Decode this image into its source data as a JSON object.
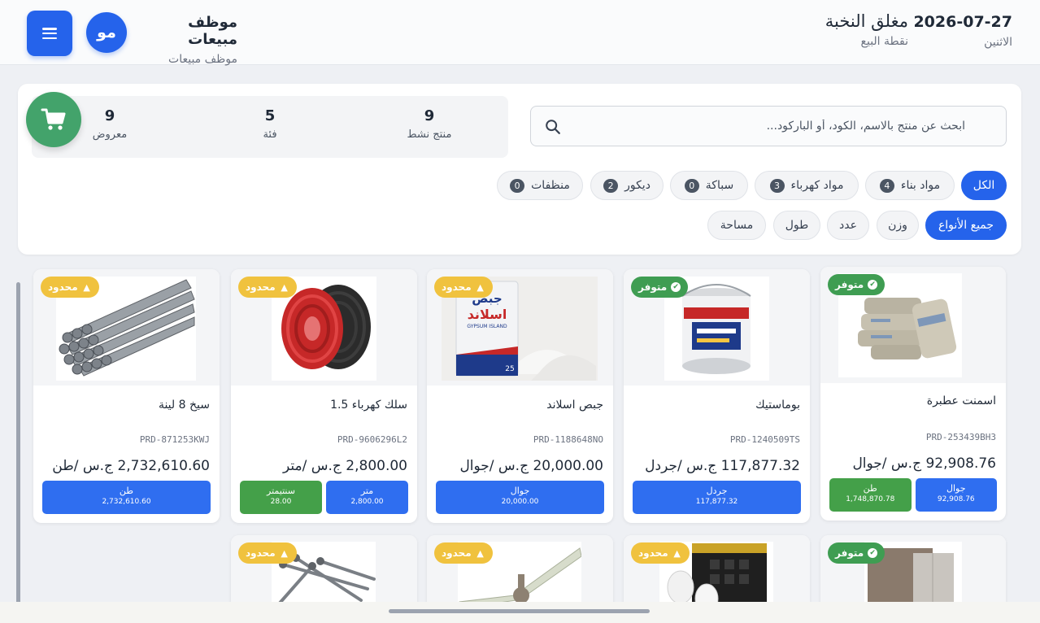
{
  "header": {
    "date": "2026-07-27",
    "weekday": "الاثنين",
    "store_name": "مغلق النخبة",
    "store_sub": "نقطة البيع",
    "user_name": "موظف مبيعات",
    "user_role": "موظف مبيعات",
    "avatar_initials": "مو",
    "menu_icon": "hamburger-icon"
  },
  "search": {
    "placeholder": "ابحث عن منتج بالاسم، الكود، أو الباركود...",
    "value": "",
    "icon": "search-icon"
  },
  "stats": [
    {
      "value": "9",
      "label": "منتج نشط"
    },
    {
      "value": "5",
      "label": "فئة"
    },
    {
      "value": "9",
      "label": "معروض"
    }
  ],
  "cart_icon": "cart-icon",
  "categories": [
    {
      "label": "الكل",
      "count": "",
      "active": true
    },
    {
      "label": "مواد بناء",
      "count": "4",
      "active": false
    },
    {
      "label": "مواد كهرباء",
      "count": "3",
      "active": false
    },
    {
      "label": "سباكة",
      "count": "0",
      "active": false
    },
    {
      "label": "ديكور",
      "count": "2",
      "active": false
    },
    {
      "label": "منظفات",
      "count": "0",
      "active": false
    }
  ],
  "unit_types": [
    {
      "label": "جميع الأنواع",
      "active": true
    },
    {
      "label": "وزن",
      "active": false
    },
    {
      "label": "عدد",
      "active": false
    },
    {
      "label": "طول",
      "active": false
    },
    {
      "label": "مساحة",
      "active": false
    }
  ],
  "colors": {
    "primary": "#2563eb",
    "success": "#3f9d52",
    "warning": "#f0c23e",
    "cart": "#43a36b"
  },
  "products": [
    {
      "name": "اسمنت عطبرة",
      "sku": "PRD-253439BH3",
      "price": "92,908.76 ج.س /جوال",
      "badge": "متوفر",
      "badge_type": "avail",
      "units": [
        {
          "name": "جوال",
          "price": "92,908.76",
          "color": "blue"
        },
        {
          "name": "طن",
          "price": "1,748,870.78",
          "color": "green"
        }
      ]
    },
    {
      "name": "بوماستيك",
      "sku": "PRD-1240509TS",
      "price": "117,877.32 ج.س /جردل",
      "badge": "متوفر",
      "badge_type": "avail",
      "units": [
        {
          "name": "جردل",
          "price": "117,877.32",
          "color": "blue"
        }
      ]
    },
    {
      "name": "جبص اسلاند",
      "sku": "PRD-1188648NO",
      "price": "20,000.00 ج.س /جوال",
      "badge": "محدود",
      "badge_type": "limited",
      "units": [
        {
          "name": "جوال",
          "price": "20,000.00",
          "color": "blue"
        }
      ]
    },
    {
      "name": "سلك كهرباء 1.5",
      "sku": "PRD-9606296L2",
      "price": "2,800.00 ج.س /متر",
      "badge": "محدود",
      "badge_type": "limited",
      "units": [
        {
          "name": "متر",
          "price": "2,800.00",
          "color": "blue"
        },
        {
          "name": "سنتيمتر",
          "price": "28.00",
          "color": "green"
        }
      ]
    },
    {
      "name": "سيخ 8 لينة",
      "sku": "PRD-871253KWJ",
      "price": "2,732,610.60 ج.س /طن",
      "badge": "محدود",
      "badge_type": "limited",
      "units": [
        {
          "name": "طن",
          "price": "2,732,610.60",
          "color": "blue"
        }
      ]
    },
    {
      "name": "",
      "sku": "",
      "price": "",
      "badge": "متوفر",
      "badge_type": "avail",
      "units": []
    },
    {
      "name": "",
      "sku": "",
      "price": "",
      "badge": "محدود",
      "badge_type": "limited",
      "units": []
    },
    {
      "name": "",
      "sku": "",
      "price": "",
      "badge": "محدود",
      "badge_type": "limited",
      "units": []
    },
    {
      "name": "",
      "sku": "",
      "price": "",
      "badge": "محدود",
      "badge_type": "limited",
      "units": []
    }
  ],
  "image_text": {
    "gypsum_title": "جبص",
    "gypsum_title2": "اسلاند",
    "gypsum_en": "GYPSUM ISLAND",
    "gypsum_weight": "25"
  }
}
